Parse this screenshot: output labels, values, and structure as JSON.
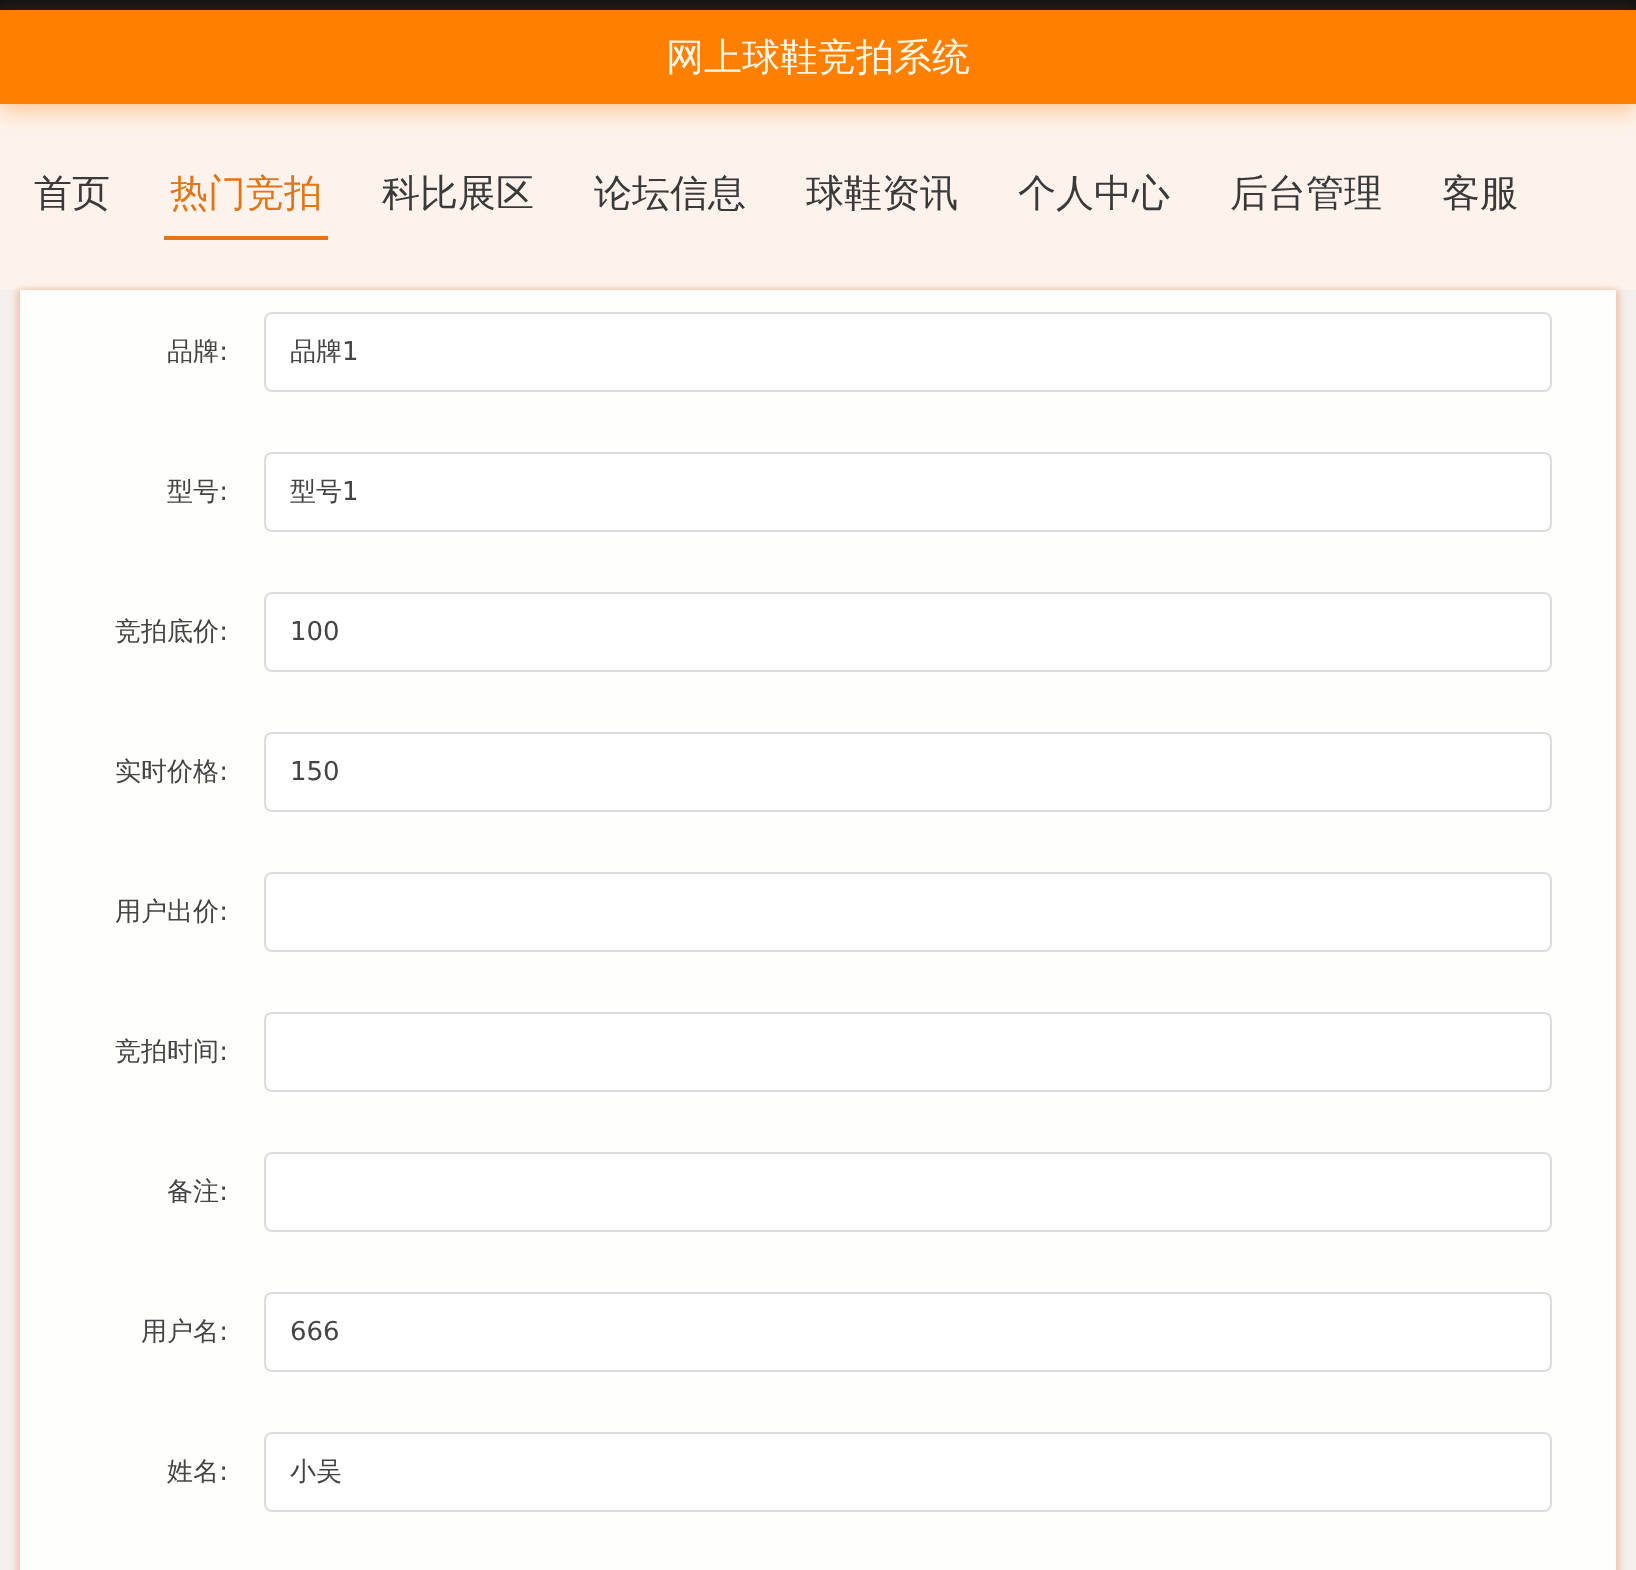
{
  "header": {
    "title": "网上球鞋竞拍系统"
  },
  "nav": [
    {
      "label": "首页",
      "selected": false
    },
    {
      "label": "热门竞拍",
      "selected": true
    },
    {
      "label": "科比展区",
      "selected": false
    },
    {
      "label": "论坛信息",
      "selected": false
    },
    {
      "label": "球鞋资讯",
      "selected": false
    },
    {
      "label": "个人中心",
      "selected": false
    },
    {
      "label": "后台管理",
      "selected": false
    },
    {
      "label": "客服",
      "selected": false
    }
  ],
  "form": {
    "fields": [
      {
        "label": "品牌:",
        "value": "品牌1"
      },
      {
        "label": "型号:",
        "value": "型号1"
      },
      {
        "label": "竞拍底价:",
        "value": "100"
      },
      {
        "label": "实时价格:",
        "value": "150"
      },
      {
        "label": "用户出价:"
      },
      {
        "label": "竞拍时间:"
      },
      {
        "label": "备注:"
      },
      {
        "label": "用户名:",
        "value": "666"
      },
      {
        "label": "姓名:",
        "value": "小吴"
      }
    ]
  }
}
